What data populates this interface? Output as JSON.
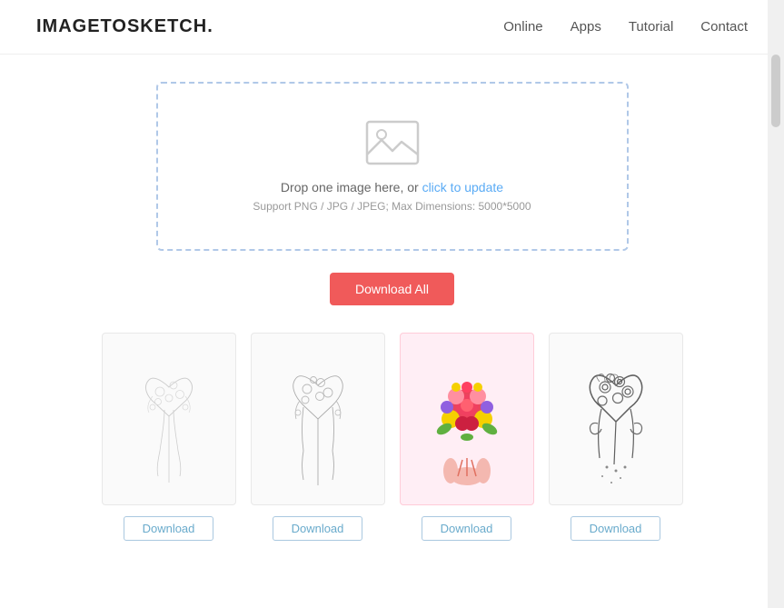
{
  "header": {
    "logo": "IMAGETOSKETCH.",
    "nav": [
      {
        "label": "Online",
        "id": "nav-online"
      },
      {
        "label": "Apps",
        "id": "nav-apps"
      },
      {
        "label": "Tutorial",
        "id": "nav-tutorial"
      },
      {
        "label": "Contact",
        "id": "nav-contact"
      }
    ]
  },
  "dropzone": {
    "main_text": "Drop one image here, or ",
    "link_text": "click to update",
    "sub_text": "Support PNG / JPG / JPEG; Max Dimensions: 5000*5000"
  },
  "download_all_button": "Download All",
  "gallery": {
    "items": [
      {
        "id": "sketch-1",
        "style": "light-sketch",
        "download_label": "Download"
      },
      {
        "id": "sketch-2",
        "style": "line-sketch",
        "download_label": "Download"
      },
      {
        "id": "sketch-3",
        "style": "color",
        "download_label": "Download"
      },
      {
        "id": "sketch-4",
        "style": "dark-sketch",
        "download_label": "Download"
      }
    ]
  }
}
